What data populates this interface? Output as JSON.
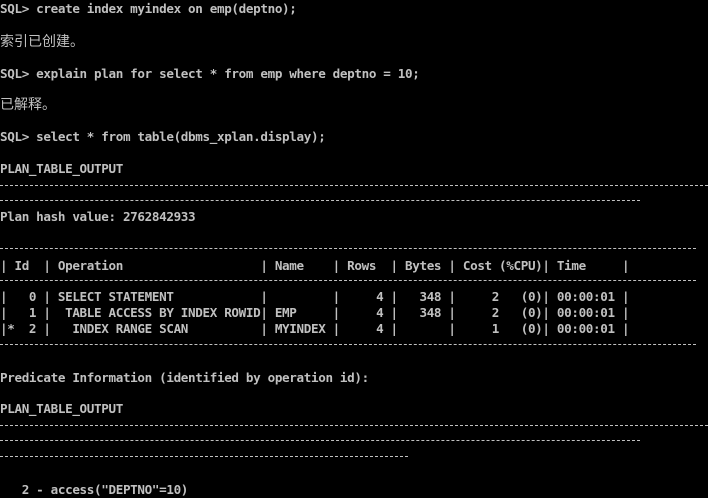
{
  "colors": {
    "background": "#000000",
    "text": "#c0c0c0"
  },
  "console": {
    "cmd_create": "SQL> create index myindex on emp(deptno);",
    "msg_index_created": "索引已创建。",
    "cmd_explain": "SQL> explain plan for select * from emp where deptno = 10;",
    "msg_explained": "已解释。",
    "cmd_display": "SQL> select * from table(dbms_xplan.display);",
    "plan_table_output_1": "PLAN_TABLE_OUTPUT",
    "plan_hash": "Plan hash value: 2762842933",
    "table_header": "| Id  | Operation                   | Name    | Rows  | Bytes | Cost (%CPU)| Time     |",
    "table_rows": [
      "|   0 | SELECT STATEMENT            |         |     4 |   348 |     2   (0)| 00:00:01 |",
      "|   1 |  TABLE ACCESS BY INDEX ROWID| EMP     |     4 |   348 |     2   (0)| 00:00:01 |",
      "|*  2 |   INDEX RANGE SCAN          | MYINDEX |     4 |       |     1   (0)| 00:00:01 |"
    ],
    "predicate_info": "Predicate Information (identified by operation id):",
    "plan_table_output_2": "PLAN_TABLE_OUTPUT",
    "predicate_access": "   2 - access(\"DEPTNO\"=10)"
  }
}
